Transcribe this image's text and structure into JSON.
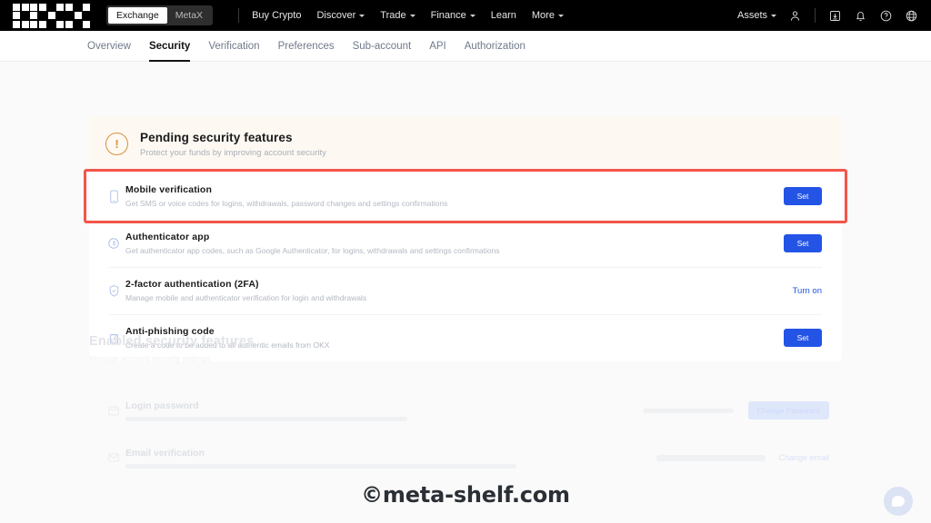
{
  "topbar": {
    "logo": "okx-logo",
    "segments": [
      {
        "label": "Exchange",
        "active": true
      },
      {
        "label": "MetaX",
        "active": false
      }
    ],
    "nav": [
      {
        "label": "Buy Crypto",
        "caret": false
      },
      {
        "label": "Discover",
        "caret": true
      },
      {
        "label": "Trade",
        "caret": true
      },
      {
        "label": "Finance",
        "caret": true
      },
      {
        "label": "Learn",
        "caret": false
      },
      {
        "label": "More",
        "caret": true
      }
    ],
    "assets_label": "Assets",
    "icons": [
      "user-icon",
      "download-icon",
      "bell-icon",
      "help-icon",
      "globe-icon"
    ]
  },
  "subnav": {
    "items": [
      {
        "label": "Overview",
        "active": false
      },
      {
        "label": "Security",
        "active": true
      },
      {
        "label": "Verification",
        "active": false
      },
      {
        "label": "Preferences",
        "active": false
      },
      {
        "label": "Sub-account",
        "active": false
      },
      {
        "label": "API",
        "active": false
      },
      {
        "label": "Authorization",
        "active": false
      }
    ]
  },
  "banner": {
    "icon": "warning-icon",
    "title": "Pending security features",
    "subtitle": "Protect your funds by improving account security"
  },
  "pending_rows": [
    {
      "icon": "mobile-phone-icon",
      "title": "Mobile verification",
      "desc": "Get SMS or voice codes for logins, withdrawals, password changes and settings confirmations",
      "action": "Set",
      "action_type": "button",
      "highlighted": true
    },
    {
      "icon": "authenticator-icon",
      "title": "Authenticator app",
      "desc": "Get authenticator app codes, such as Google Authenticator, for logins, withdrawals and settings confirmations",
      "action": "Set",
      "action_type": "button",
      "highlighted": false
    },
    {
      "icon": "shield-check-icon",
      "title": "2-factor authentication (2FA)",
      "desc": "Manage mobile and authenticator verification for login and withdrawals",
      "action": "Turn on",
      "action_type": "link",
      "highlighted": false
    },
    {
      "icon": "lock-safe-icon",
      "title": "Anti-phishing code",
      "desc": "Create a code to be added to all authentic emails from OKX",
      "action": "Set",
      "action_type": "button",
      "highlighted": false
    }
  ],
  "enabled_section": {
    "title": "Enabled security features",
    "subtitle": "Manage account security settings",
    "rows": [
      {
        "icon": "password-card-icon",
        "title": "Login password",
        "desc": "",
        "action": "Change Password",
        "action_type": "button"
      },
      {
        "icon": "email-icon",
        "title": "Email verification",
        "desc": "",
        "action": "Change email",
        "action_type": "link"
      }
    ]
  },
  "watermark": "©meta-shelf.com",
  "chat": {
    "icon": "chat-bubble-icon"
  },
  "colors": {
    "accent_blue": "#2354e6",
    "highlight_red": "#f4554a",
    "warn_orange": "#d98f3d",
    "banner_bg": "#fdf9f2",
    "page_bg": "#fafafa"
  }
}
